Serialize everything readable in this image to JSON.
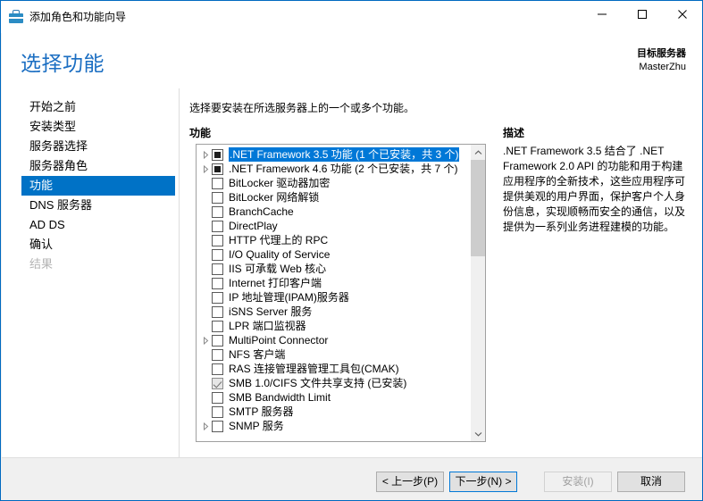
{
  "window": {
    "title": "添加角色和功能向导",
    "app_icon": "toolbox-icon",
    "controls": {
      "minimize": "minimize-icon",
      "maximize": "maximize-icon",
      "close": "close-icon"
    },
    "accent_color": "#0069c0"
  },
  "header": {
    "page_title": "选择功能",
    "target_server_label": "目标服务器",
    "target_server_name": "MasterZhu",
    "title_color": "#1b6ec2"
  },
  "sidebar": {
    "items": [
      {
        "label": "开始之前",
        "state": "normal"
      },
      {
        "label": "安装类型",
        "state": "normal"
      },
      {
        "label": "服务器选择",
        "state": "normal"
      },
      {
        "label": "服务器角色",
        "state": "normal"
      },
      {
        "label": "功能",
        "state": "active"
      },
      {
        "label": "DNS 服务器",
        "state": "normal"
      },
      {
        "label": "AD DS",
        "state": "normal"
      },
      {
        "label": "确认",
        "state": "normal"
      },
      {
        "label": "结果",
        "state": "disabled"
      }
    ],
    "active_color": "#0072c6"
  },
  "main": {
    "instruction": "选择要安装在所选服务器上的一个或多个功能。",
    "list_label": "功能",
    "features": [
      {
        "label": ".NET Framework 3.5 功能 (1 个已安装，共 3 个)",
        "checkbox": "partial",
        "expander": true,
        "selected": true
      },
      {
        "label": ".NET Framework 4.6 功能 (2 个已安装，共 7 个)",
        "checkbox": "partial",
        "expander": true,
        "selected": false
      },
      {
        "label": "BitLocker 驱动器加密",
        "checkbox": "unchecked",
        "expander": false,
        "selected": false
      },
      {
        "label": "BitLocker 网络解锁",
        "checkbox": "unchecked",
        "expander": false,
        "selected": false
      },
      {
        "label": "BranchCache",
        "checkbox": "unchecked",
        "expander": false,
        "selected": false
      },
      {
        "label": "DirectPlay",
        "checkbox": "unchecked",
        "expander": false,
        "selected": false
      },
      {
        "label": "HTTP 代理上的 RPC",
        "checkbox": "unchecked",
        "expander": false,
        "selected": false
      },
      {
        "label": "I/O Quality of Service",
        "checkbox": "unchecked",
        "expander": false,
        "selected": false
      },
      {
        "label": "IIS 可承载 Web 核心",
        "checkbox": "unchecked",
        "expander": false,
        "selected": false
      },
      {
        "label": "Internet 打印客户端",
        "checkbox": "unchecked",
        "expander": false,
        "selected": false
      },
      {
        "label": "IP 地址管理(IPAM)服务器",
        "checkbox": "unchecked",
        "expander": false,
        "selected": false
      },
      {
        "label": "iSNS Server 服务",
        "checkbox": "unchecked",
        "expander": false,
        "selected": false
      },
      {
        "label": "LPR 端口监视器",
        "checkbox": "unchecked",
        "expander": false,
        "selected": false
      },
      {
        "label": "MultiPoint Connector",
        "checkbox": "unchecked",
        "expander": true,
        "selected": false
      },
      {
        "label": "NFS 客户端",
        "checkbox": "unchecked",
        "expander": false,
        "selected": false
      },
      {
        "label": "RAS 连接管理器管理工具包(CMAK)",
        "checkbox": "unchecked",
        "expander": false,
        "selected": false
      },
      {
        "label": "SMB 1.0/CIFS 文件共享支持 (已安装)",
        "checkbox": "installed",
        "expander": false,
        "selected": false
      },
      {
        "label": "SMB Bandwidth Limit",
        "checkbox": "unchecked",
        "expander": false,
        "selected": false
      },
      {
        "label": "SMTP 服务器",
        "checkbox": "unchecked",
        "expander": false,
        "selected": false
      },
      {
        "label": "SNMP 服务",
        "checkbox": "unchecked",
        "expander": true,
        "selected": false
      }
    ],
    "scrollbar": {
      "up_icon": "chevron-up-icon",
      "down_icon": "chevron-down-icon"
    },
    "selection_color": "#0078d7"
  },
  "description": {
    "label": "描述",
    "text": ".NET Framework 3.5 结合了 .NET Framework 2.0 API 的功能和用于构建应用程序的全新技术，这些应用程序可提供美观的用户界面，保护客户个人身份信息，实现顺畅而安全的通信，以及提供为一系列业务进程建模的功能。"
  },
  "footer": {
    "previous_label": "< 上一步(P)",
    "next_label": "下一步(N) >",
    "install_label": "安装(I)",
    "cancel_label": "取消",
    "focus_color": "#0078d7"
  }
}
